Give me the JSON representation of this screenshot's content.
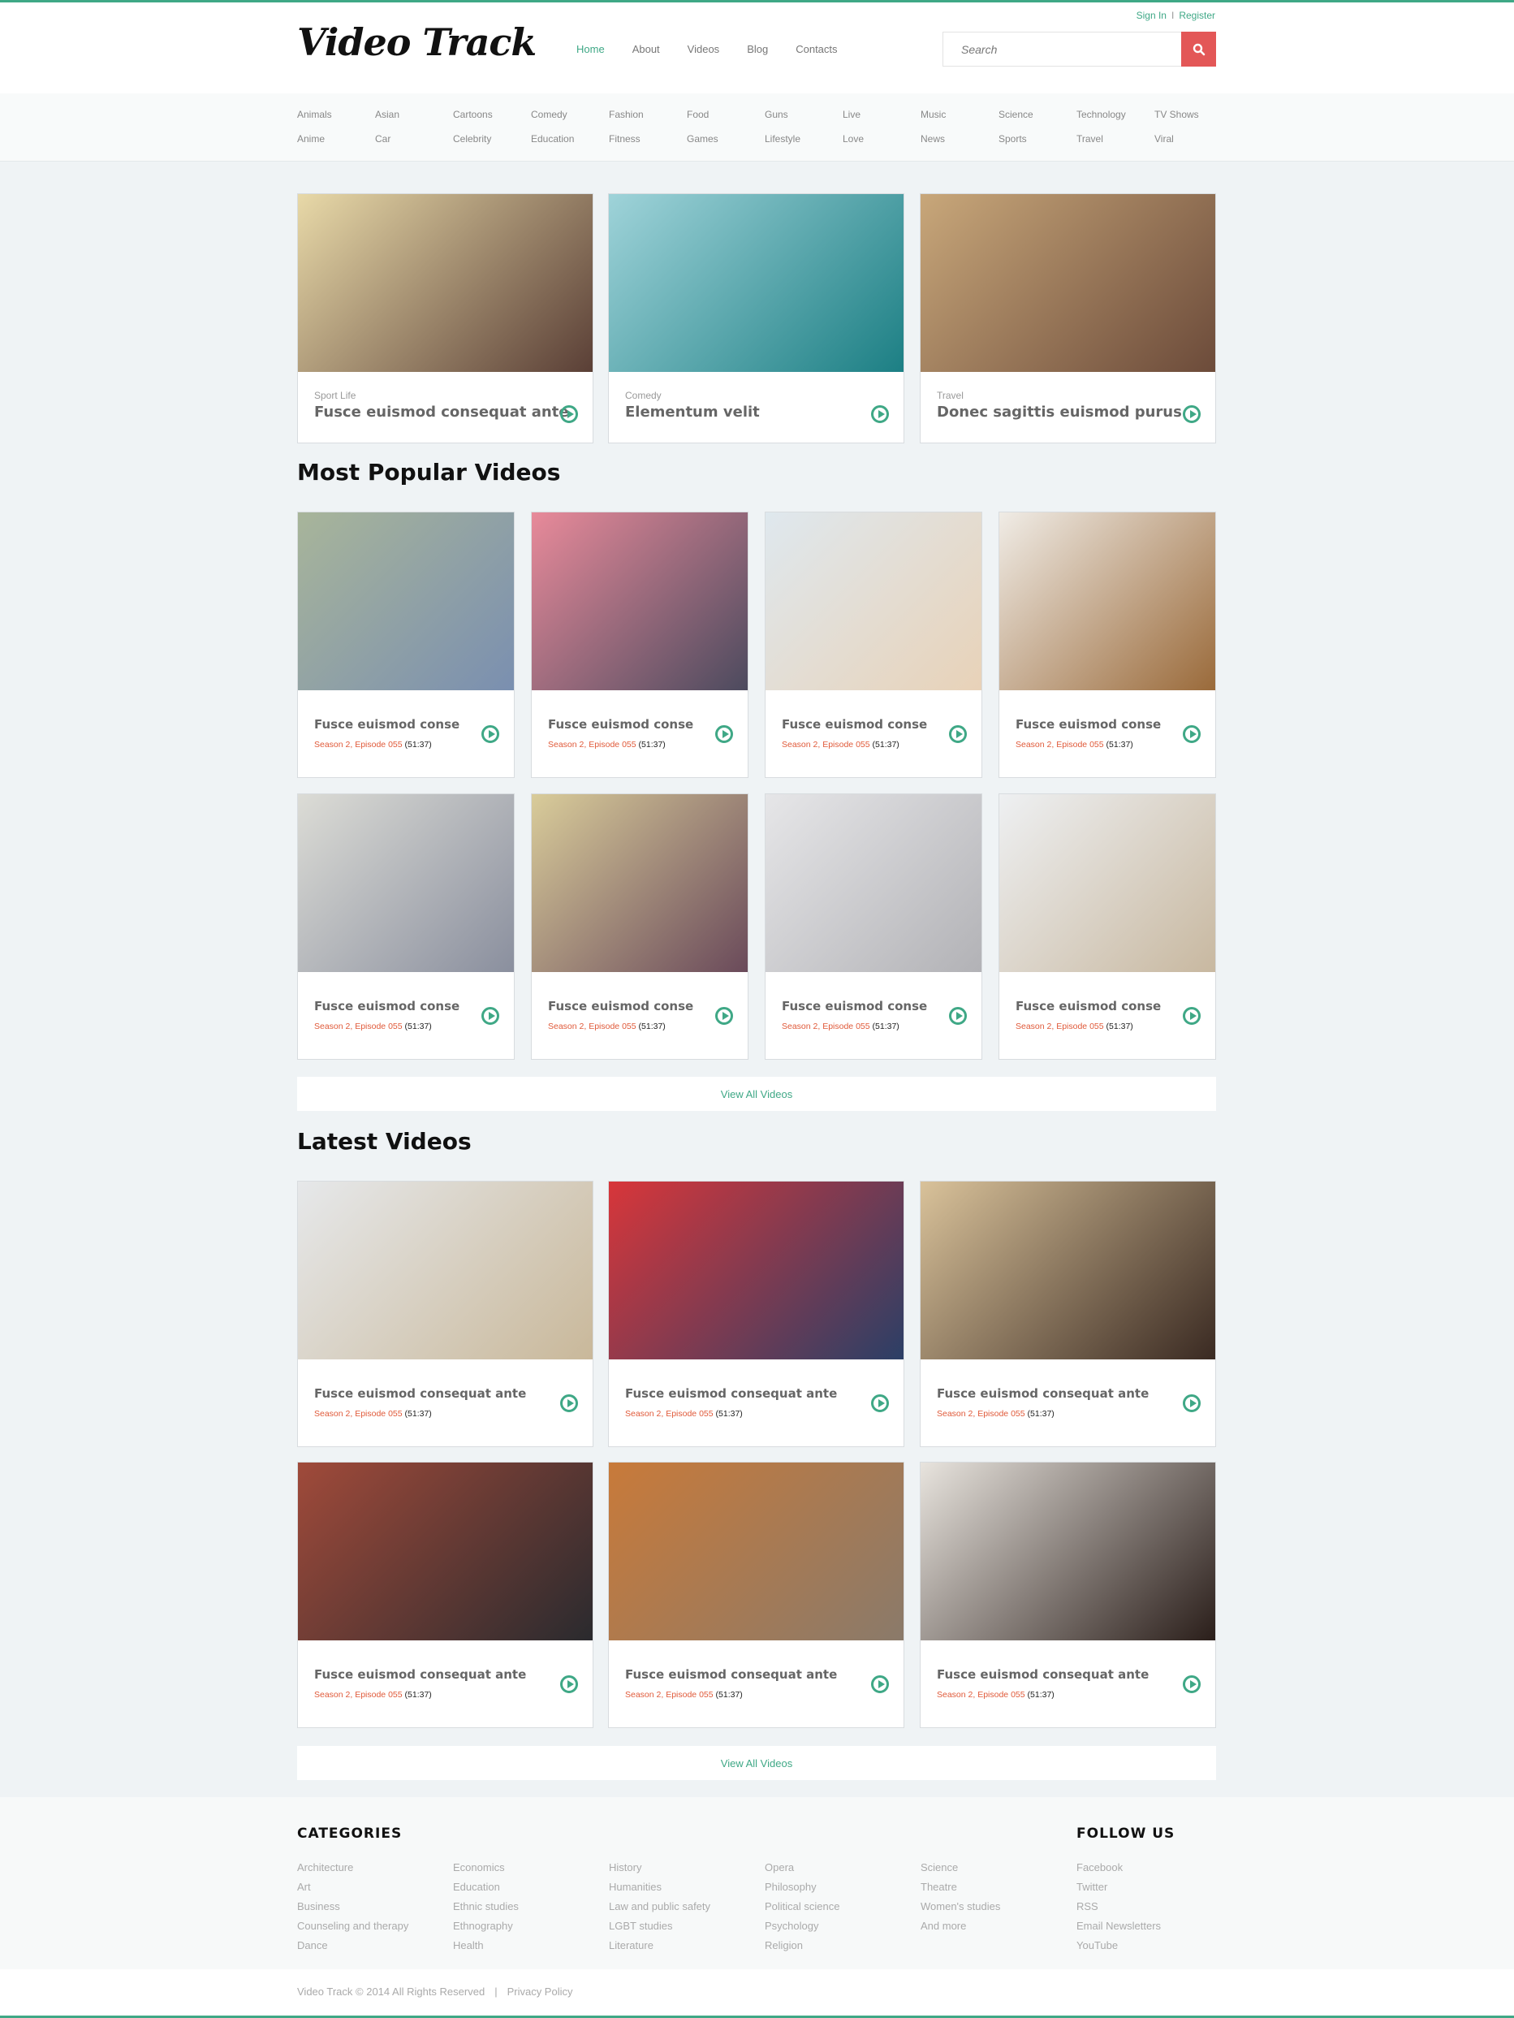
{
  "header": {
    "logo": "Video Track",
    "nav": [
      {
        "label": "Home",
        "active": true
      },
      {
        "label": "About",
        "active": false
      },
      {
        "label": "Videos",
        "active": false
      },
      {
        "label": "Blog",
        "active": false
      },
      {
        "label": "Contacts",
        "active": false
      }
    ],
    "sign_in": "Sign In",
    "auth_separator": "I",
    "register": "Register",
    "search_placeholder": "Search"
  },
  "categories_bar": [
    "Animals",
    "Asian",
    "Cartoons",
    "Comedy",
    "Fashion",
    "Food",
    "Guns",
    "Live",
    "Music",
    "Science",
    "Technology",
    "TV Shows",
    "Anime",
    "Car",
    "Celebrity",
    "Education",
    "Fitness",
    "Games",
    "Lifestyle",
    "Love",
    "News",
    "Sports",
    "Travel",
    "Viral"
  ],
  "featured": [
    {
      "category": "Sport Life",
      "title": "Fusce euismod consequat ante",
      "image": "running-shoe-photo",
      "c1": "#e8d9a8",
      "c2": "#5a3f36"
    },
    {
      "category": "Comedy",
      "title": "Elementum velit",
      "image": "ocean-wave-photo",
      "c1": "#9fd3d9",
      "c2": "#1c7f84"
    },
    {
      "category": "Travel",
      "title": "Donec sagittis euismod purus",
      "image": "couple-kissing-bicycle-photo",
      "c1": "#c8a77a",
      "c2": "#6c4b3a"
    }
  ],
  "popular": {
    "heading": "Most Popular Videos",
    "items": [
      {
        "title": "Fusce euismod conse",
        "episode": "Season 2, Episode 055",
        "duration": "(51:37)",
        "image": "smiling-couple-photo",
        "c1": "#a8b59a",
        "c2": "#7a8fb0"
      },
      {
        "title": "Fusce euismod conse",
        "episode": "Season 2, Episode 055",
        "duration": "(51:37)",
        "image": "girl-with-balloons-photo",
        "c1": "#e88a9a",
        "c2": "#4c4a5e"
      },
      {
        "title": "Fusce euismod conse",
        "episode": "Season 2, Episode 055",
        "duration": "(51:37)",
        "image": "beach-balloons-photo",
        "c1": "#dfe8ee",
        "c2": "#e8d2b8"
      },
      {
        "title": "Fusce euismod conse",
        "episode": "Season 2, Episode 055",
        "duration": "(51:37)",
        "image": "family-dinner-photo",
        "c1": "#f0ece6",
        "c2": "#9a6a3a"
      },
      {
        "title": "Fusce euismod conse",
        "episode": "Season 2, Episode 055",
        "duration": "(51:37)",
        "image": "tourists-with-map-photo",
        "c1": "#dcdcd6",
        "c2": "#8a8f9e"
      },
      {
        "title": "Fusce euismod conse",
        "episode": "Season 2, Episode 055",
        "duration": "(51:37)",
        "image": "vintage-car-road-photo",
        "c1": "#d9cc9a",
        "c2": "#6a4a5a"
      },
      {
        "title": "Fusce euismod conse",
        "episode": "Season 2, Episode 055",
        "duration": "(51:37)",
        "image": "bride-photo",
        "c1": "#e6e6e8",
        "c2": "#b2b2b6"
      },
      {
        "title": "Fusce euismod conse",
        "episode": "Season 2, Episode 055",
        "duration": "(51:37)",
        "image": "champagne-desserts-photo",
        "c1": "#eef0f2",
        "c2": "#c8b8a0"
      }
    ],
    "view_all": "View All Videos"
  },
  "latest": {
    "heading": "Latest Videos",
    "items": [
      {
        "title": "Fusce euismod consequat ante",
        "episode": "Season 2, Episode 055",
        "duration": "(51:37)",
        "image": "blonde-woman-photo",
        "c1": "#e6e8ea",
        "c2": "#c9b89a"
      },
      {
        "title": "Fusce euismod consequat ante",
        "episode": "Season 2, Episode 055",
        "duration": "(51:37)",
        "image": "firefighters-photo",
        "c1": "#d8363a",
        "c2": "#2b3f66"
      },
      {
        "title": "Fusce euismod consequat ante",
        "episode": "Season 2, Episode 055",
        "duration": "(51:37)",
        "image": "bull-rider-photo",
        "c1": "#d9c29a",
        "c2": "#3a2a22"
      },
      {
        "title": "Fusce euismod consequat ante",
        "episode": "Season 2, Episode 055",
        "duration": "(51:37)",
        "image": "stormy-road-photo",
        "c1": "#a04a3a",
        "c2": "#2a2a2e"
      },
      {
        "title": "Fusce euismod consequat ante",
        "episode": "Season 2, Episode 055",
        "duration": "(51:37)",
        "image": "couple-on-bench-photo",
        "c1": "#c87a3a",
        "c2": "#8a7a6a"
      },
      {
        "title": "Fusce euismod consequat ante",
        "episode": "Season 2, Episode 055",
        "duration": "(51:37)",
        "image": "elegant-couple-photo",
        "c1": "#e8e4de",
        "c2": "#2a1e1a"
      }
    ],
    "view_all": "View All Videos"
  },
  "footer": {
    "categories_heading": "CATEGORIES",
    "categories_columns": [
      [
        "Architecture",
        "Art",
        "Business",
        "Counseling and therapy",
        "Dance"
      ],
      [
        "Economics",
        "Education",
        "Ethnic studies",
        "Ethnography",
        "Health"
      ],
      [
        "History",
        "Humanities",
        "Law and public safety",
        "LGBT studies",
        "Literature"
      ],
      [
        "Opera",
        "Philosophy",
        "Political science",
        "Psychology",
        "Religion"
      ],
      [
        "Science",
        "Theatre",
        "Women's studies",
        "And more"
      ]
    ],
    "follow_heading": "FOLLOW US",
    "follow_links": [
      "Facebook",
      "Twitter",
      "RSS",
      "Email Newsletters",
      "YouTube"
    ],
    "copyright": "Video Track © 2014 All Rights Reserved",
    "separator": "|",
    "privacy": "Privacy Policy"
  },
  "colors": {
    "accent": "#3fa886",
    "search_button": "#e35757",
    "episode_text": "#e05a3a"
  }
}
